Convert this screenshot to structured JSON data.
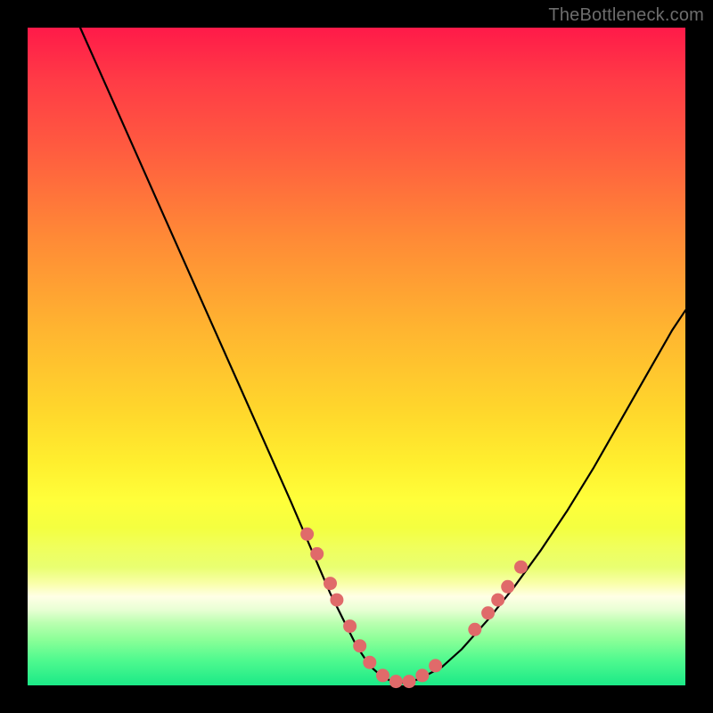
{
  "watermark": "TheBottleneck.com",
  "colors": {
    "dot": "#e06a6a",
    "curve": "#000000",
    "frame": "#000000"
  },
  "chart_data": {
    "type": "line",
    "title": "",
    "xlabel": "",
    "ylabel": "",
    "xlim": [
      0,
      100
    ],
    "ylim": [
      0,
      100
    ],
    "grid": false,
    "legend": false,
    "series": [
      {
        "name": "bottleneck-curve",
        "x": [
          8,
          12,
          16,
          20,
          24,
          28,
          32,
          36,
          40,
          43,
          46,
          48,
          50,
          52,
          54,
          56,
          58,
          60,
          63,
          66,
          70,
          74,
          78,
          82,
          86,
          90,
          94,
          98,
          100
        ],
        "y": [
          100,
          91,
          82,
          73,
          64,
          55,
          46,
          37,
          28,
          21,
          14,
          10,
          6,
          3,
          1.2,
          0.4,
          0.4,
          1.2,
          2.8,
          5.5,
          10,
          15,
          20.5,
          26.5,
          33,
          40,
          47,
          54,
          57
        ]
      }
    ],
    "points": [
      {
        "name": "left-cluster",
        "coords": [
          [
            42.5,
            23.0
          ],
          [
            44.0,
            20.0
          ],
          [
            46.0,
            15.5
          ],
          [
            47.0,
            13.0
          ],
          [
            49.0,
            9.0
          ],
          [
            50.5,
            6.0
          ],
          [
            52.0,
            3.5
          ],
          [
            54.0,
            1.5
          ],
          [
            56.0,
            0.6
          ],
          [
            58.0,
            0.6
          ],
          [
            60.0,
            1.5
          ],
          [
            62.0,
            3.0
          ]
        ]
      },
      {
        "name": "right-cluster",
        "coords": [
          [
            68.0,
            8.5
          ],
          [
            70.0,
            11.0
          ],
          [
            71.5,
            13.0
          ],
          [
            73.0,
            15.0
          ],
          [
            75.0,
            18.0
          ]
        ]
      }
    ]
  }
}
